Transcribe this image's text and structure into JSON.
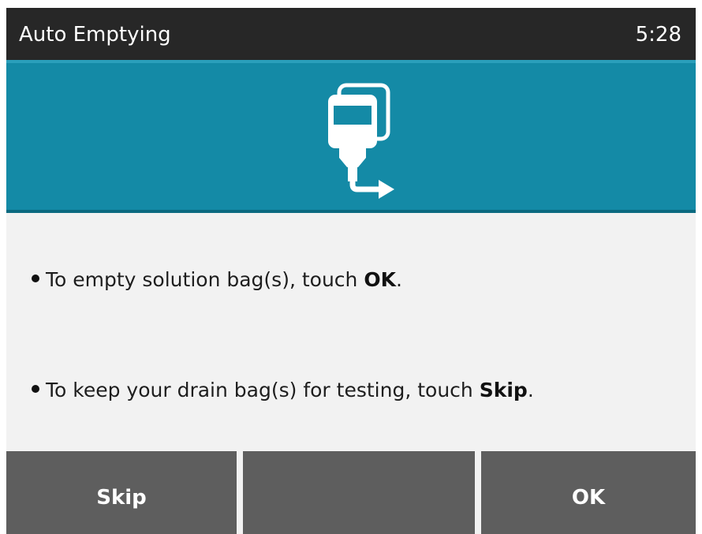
{
  "header": {
    "title": "Auto Emptying",
    "time": "5:28"
  },
  "banner": {
    "icon": "bag-drain-icon",
    "background_color": "#148aa6"
  },
  "instructions": [
    {
      "text": "To empty solution bag(s), touch ",
      "emphasis": "OK",
      "suffix": "."
    },
    {
      "text": "To keep your drain bag(s) for testing, touch ",
      "emphasis": "Skip",
      "suffix": "."
    }
  ],
  "footer": {
    "left_label": "Skip",
    "middle_label": "",
    "right_label": "OK"
  }
}
